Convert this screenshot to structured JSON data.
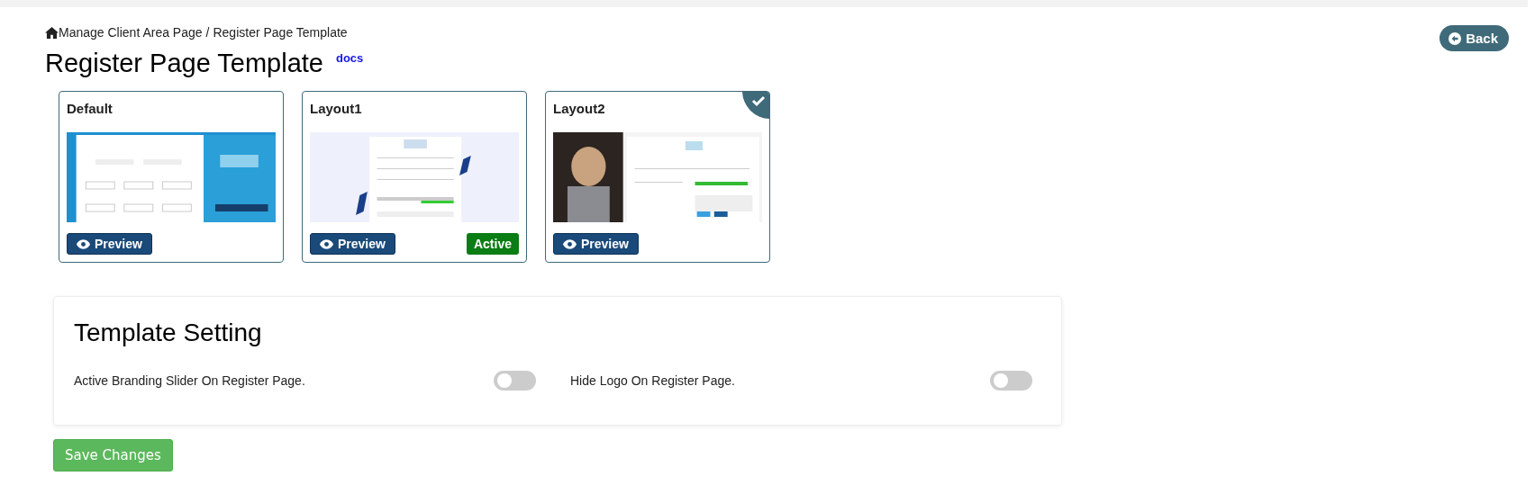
{
  "breadcrumb": {
    "parent": "Manage Client Area Page",
    "separator": "/",
    "current": "Register Page Template"
  },
  "back_button": {
    "label": "Back"
  },
  "title": "Register Page Template",
  "docs_link": "docs",
  "templates": [
    {
      "name": "Default",
      "kind": "split",
      "selected": false,
      "preview": "Preview"
    },
    {
      "name": "Layout1",
      "kind": "centered",
      "selected": false,
      "preview": "Preview",
      "badge": "Active"
    },
    {
      "name": "Layout2",
      "kind": "photo",
      "selected": true,
      "preview": "Preview"
    }
  ],
  "settings": {
    "title": "Template Setting",
    "toggles": [
      {
        "label": "Active Branding Slider On Register Page.",
        "on": false
      },
      {
        "label": "Hide Logo On Register Page.",
        "on": false
      }
    ]
  },
  "save_button": "Save Changes"
}
